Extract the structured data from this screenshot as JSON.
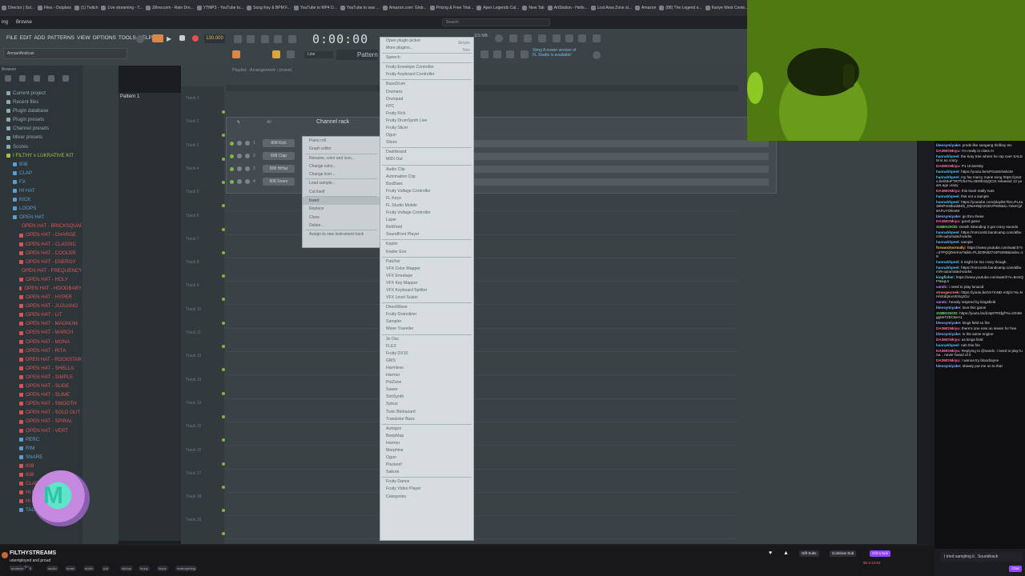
{
  "bookmarks": [
    "Director | Sol...",
    "Files - Dropbox",
    "(1) Twitch",
    "Live streaming - T...",
    "Zillow.com - Rain Dro...",
    "YTMP3 - YouTube to...",
    "Song Key & BPM F...",
    "YouTube to MP4 D...",
    "YouTube to wav ...",
    "Amazon.com: Glob...",
    "Pricing & Free Trial...",
    "Apex Legends Cal...",
    "New Tab",
    "ArtStation - Hello...",
    "Lost Area Zone st...",
    "Amazon",
    "(88) The Legend o...",
    "Kanye West Conte...",
    "Visually Plan, Man..."
  ],
  "topbar": {
    "left1": "ing",
    "left2": "Browse",
    "search_placeholder": "Search"
  },
  "fl": {
    "menu": [
      "FILE",
      "EDIT",
      "ADD",
      "PATTERNS",
      "VIEW",
      "OPTIONS",
      "TOOLS",
      "HELP"
    ],
    "hint": "AnnaelAndican",
    "bpm": "130.000",
    "time": "0:00:00",
    "pattern_label": "Pattern",
    "snap_label": "Line",
    "notice_line1": "Strng  A newer version of",
    "notice_line2": "FL Studio is available!",
    "memory": "115 MB",
    "browser_title": "Browser",
    "playlist_title": "Playlist - Arrangement › (none)"
  },
  "browser_tree": [
    {
      "label": "Current project",
      "color": "#8fa8b3"
    },
    {
      "label": "Recent files",
      "color": "#8fa8b3"
    },
    {
      "label": "Plugin database",
      "color": "#8fa8b3"
    },
    {
      "label": "Plugin presets",
      "color": "#8fa8b3"
    },
    {
      "label": "Channel presets",
      "color": "#8fa8b3"
    },
    {
      "label": "Mixer presets",
      "color": "#8fa8b3"
    },
    {
      "label": "Scores",
      "color": "#8fa8b3"
    },
    {
      "label": "I FILTHY x LUKRATIVE KIT",
      "color": "#9fc24b"
    },
    {
      "label": "808",
      "color": "#5b9ed1"
    },
    {
      "label": "CLAP",
      "color": "#5b9ed1"
    },
    {
      "label": "FX",
      "color": "#5b9ed1"
    },
    {
      "label": "HI HAT",
      "color": "#5b9ed1"
    },
    {
      "label": "KICK",
      "color": "#5b9ed1"
    },
    {
      "label": "LOOPS",
      "color": "#5b9ed1"
    },
    {
      "label": "OPEN HAT",
      "color": "#5b9ed1"
    },
    {
      "label": "OPEN HAT - BRICKSQUAD",
      "color": "#d9555e"
    },
    {
      "label": "OPEN HAT - CHARGE",
      "color": "#d9555e"
    },
    {
      "label": "OPEN HAT - CLASSIC",
      "color": "#d9555e"
    },
    {
      "label": "OPEN HAT - COOLER",
      "color": "#d9555e"
    },
    {
      "label": "OPEN HAT - ENERGY",
      "color": "#d9555e"
    },
    {
      "label": "OPEN HAT - FREQUENCY",
      "color": "#d9555e"
    },
    {
      "label": "OPEN HAT - HOLY",
      "color": "#d9555e"
    },
    {
      "label": "OPEN HAT - HOODBABY",
      "color": "#d9555e"
    },
    {
      "label": "OPEN HAT - HYPER",
      "color": "#d9555e"
    },
    {
      "label": "OPEN HAT - JUJUANO",
      "color": "#d9555e"
    },
    {
      "label": "OPEN HAT - LIT",
      "color": "#d9555e"
    },
    {
      "label": "OPEN HAT - MAGNUM",
      "color": "#d9555e"
    },
    {
      "label": "OPEN HAT - MARCH",
      "color": "#d9555e"
    },
    {
      "label": "OPEN HAT - MONA",
      "color": "#d9555e"
    },
    {
      "label": "OPEN HAT - RITA",
      "color": "#d9555e"
    },
    {
      "label": "OPEN HAT - ROCKSTAR",
      "color": "#d9555e"
    },
    {
      "label": "OPEN HAT - SHELLS",
      "color": "#d9555e"
    },
    {
      "label": "OPEN HAT - SIMPLE",
      "color": "#d9555e"
    },
    {
      "label": "OPEN HAT - SLIDE",
      "color": "#d9555e"
    },
    {
      "label": "OPEN HAT - SLIME",
      "color": "#d9555e"
    },
    {
      "label": "OPEN HAT - SMOOTH",
      "color": "#d9555e"
    },
    {
      "label": "OPEN HAT - SOLD OUT",
      "color": "#d9555e"
    },
    {
      "label": "OPEN HAT - SPIRAL",
      "color": "#d9555e"
    },
    {
      "label": "OPEN HAT - VERT",
      "color": "#d9555e"
    },
    {
      "label": "PERC",
      "color": "#5b9ed1"
    },
    {
      "label": "RIM",
      "color": "#5b9ed1"
    },
    {
      "label": "SNARE",
      "color": "#5b9ed1"
    },
    {
      "label": "808",
      "color": "#d9555e"
    },
    {
      "label": "808",
      "color": "#d9555e"
    },
    {
      "label": "CLAP",
      "color": "#d9555e"
    },
    {
      "label": "HI HAT",
      "color": "#d9555e"
    },
    {
      "label": "HI HAT - DARK",
      "color": "#d9555e"
    },
    {
      "label": "TAGS",
      "color": "#5b9ed1"
    }
  ],
  "pattern": "Pattern 1",
  "tracks": [
    "Track 1",
    "Track 2",
    "Track 3",
    "Track 4",
    "Track 5",
    "Track 6",
    "Track 7",
    "Track 8",
    "Track 9",
    "Track 10",
    "Track 11",
    "Track 12",
    "Track 13",
    "Track 14",
    "Track 15",
    "Track 16",
    "Track 17",
    "Track 18",
    "Track 19"
  ],
  "channel_rack": {
    "title": "Channel rack",
    "filter": "All",
    "channels": [
      {
        "num": "1",
        "name": "808 Kick"
      },
      {
        "num": "2",
        "name": "808 Clap"
      },
      {
        "num": "3",
        "name": "808 HiHat"
      },
      {
        "num": "4",
        "name": "808 Snare"
      }
    ]
  },
  "context_menu": {
    "items": [
      "Piano roll",
      "Graph editor",
      "-",
      "Rename, color and icon...",
      "Change color...",
      "Change icon...",
      "-",
      "Load sample...",
      "Cut itself",
      "-",
      "Insert",
      "Replace",
      "Clone",
      "Delete...",
      "-",
      "Assign to new instrument track"
    ],
    "tail": [
      "Clone",
      "Delete..."
    ]
  },
  "submenu": {
    "side_labels": [
      "Simple",
      "Tree"
    ],
    "items": [
      "Open plugin picker",
      "More plugins...",
      "-",
      "Speech",
      "-",
      "Fruity Envelope Controller",
      "Fruity Keyboard Controller",
      "-",
      "BassDrum",
      "Drumaxx",
      "Drumpad",
      "FPC",
      "Fruity Kick",
      "Fruity DrumSynth Live",
      "Fruity Slicer",
      "Ogun",
      "Slicex",
      "-",
      "Dashboard",
      "MIDI Out",
      "-",
      "Audio Clip",
      "Automation Clip",
      "BooBass",
      "Fruity Voltage Controller",
      "FL Keys",
      "FL Studio Mobile",
      "Fruity Voltage Controller",
      "Layer",
      "ReWired",
      "SoundFont Player",
      "-",
      "Kepler",
      "Kepler Exo",
      "-",
      "Patcher",
      "VFX Color Mapper",
      "VFX Envelope",
      "VFX Key Mapper",
      "VFX Keyboard Splitter",
      "VFX Level Scaler",
      "-",
      "DirectWave",
      "Fruity Granulizer",
      "Sampler",
      "Wave Traveller",
      "-",
      "3x Osc",
      "FLEX",
      "Fruity DX10",
      "GMS",
      "Harmless",
      "Harmor",
      "PoiZone",
      "Sawer",
      "SimSynth",
      "Sytrus",
      "Toxic Biohazard",
      "Transistor Bass",
      "-",
      "Autogun",
      "BeepMap",
      "Harmor",
      "Morphine",
      "Ogun",
      "Plucked!",
      "Sakura",
      "-",
      "Fruity Dance",
      "Fruity Video Player",
      "Categories"
    ]
  },
  "chat": [
    {
      "user": "blessymiyake:",
      "text": "prods like sangang thrilboy etc",
      "color": "#7fb3ff"
    },
    {
      "user": "DA3MONkiyu:",
      "text": "I'm really in class rn",
      "color": "#ff6fa8"
    },
    {
      "user": "hannahhpeel:",
      "text": "the kray tree where he rap over SALEM is so crazy",
      "color": "#4cc3ff"
    },
    {
      "user": "DA3MONkiyu:",
      "text": "P1 University",
      "color": "#ff6fa8"
    },
    {
      "user": "hannahhpeel:",
      "text": "https://youtu.be/uFDu8mhwkcM",
      "color": "#4cc3ff"
    },
    {
      "user": "hannahhpeel:",
      "text": "my fav marcy mane song https://youtu.be/83oFTR7fVb4?si=5D9f2I2jQCtX released 12 years ago crazy",
      "color": "#4cc3ff"
    },
    {
      "user": "DA3MONkiyu:",
      "text": "this track really nuts",
      "color": "#ff6fa8"
    },
    {
      "user": "hannahhpeel:",
      "text": "this not a sample",
      "color": "#4cc3ff"
    },
    {
      "user": "hannahhpeel:",
      "text": "https://youtube.com/playlist?list=PL4a38NPm5tkw3BSb_DNeHWjn2GEVP8W&si=7ekeCjZ8AFUYOEmM",
      "color": "#4cc3ff"
    },
    {
      "user": "blessymiyake:",
      "text": "go thru these",
      "color": "#7fb3ff"
    },
    {
      "user": "DA3MONkiyu:",
      "text": "good game",
      "color": "#ff6fa8"
    },
    {
      "user": "318BGOIOD:",
      "text": "Death Stranding 2 got crazy sounds",
      "color": "#6be36b"
    },
    {
      "user": "hannahhpeel:",
      "text": "https://mmcords.bandcamp.com/album/9-automated-works",
      "color": "#4cc3ff"
    },
    {
      "user": "hannahhpeel:",
      "text": "sample",
      "color": "#4cc3ff"
    },
    {
      "user": "forwardnormally:",
      "text": "https://www.youtube.com/watch?v=37PQQ0mrKw7&list=PL2D0N82744F5098&index=19",
      "color": "#ffb347"
    },
    {
      "user": "hannahhpeel:",
      "text": "it might be too crazy though",
      "color": "#4cc3ff"
    },
    {
      "user": "hannahhpeel:",
      "text": "https://mmcords.bandcamp.com/album/9-automated-works",
      "color": "#4cc3ff"
    },
    {
      "user": "kingfisher:",
      "text": "https://www.youtube.com/watch?v=9cmQFNxqL0",
      "color": "#67d1c9"
    },
    {
      "user": "vandc:",
      "text": "i need to play lunacid",
      "color": "#c285ff"
    },
    {
      "user": "strangecreek:",
      "text": "https://youtu.be/2n7mND-m0j2c?si=NHNSdqmxVESqJCU",
      "color": "#ff8080"
    },
    {
      "user": "vandc:",
      "text": "heavily inspired by kingsfield",
      "color": "#c285ff"
    },
    {
      "user": "blessymiyake:",
      "text": "love this game",
      "color": "#7fb3ff"
    },
    {
      "user": "318BGOIOD:",
      "text": "https://youtu.be/dJq87RSfgf?si=G04Mgg0eT2EC6eA1",
      "color": "#6be36b"
    },
    {
      "user": "blessymiyake:",
      "text": "kings field so fire",
      "color": "#7fb3ff"
    },
    {
      "user": "DA3MONkiyu:",
      "text": "there's one new on steam for free",
      "color": "#ff6fa8"
    },
    {
      "user": "blessymiyake:",
      "text": "in the same engine",
      "color": "#7fb3ff"
    },
    {
      "user": "DA3MONkiyu:",
      "text": "as kings field",
      "color": "#ff6fa8"
    },
    {
      "user": "hannahhpeel:",
      "text": "nah this fire",
      "color": "#4cc3ff"
    },
    {
      "user": "DA3MONkiyu:",
      "text": "Replying to @vandc: i need to play luna... never heard of it",
      "color": "#ff6fa8"
    },
    {
      "user": "DA3MONkiyu:",
      "text": "i wanna try bloodrayne",
      "color": "#ff6fa8"
    },
    {
      "user": "blessymiyake:",
      "text": "shawty put me on to that",
      "color": "#7fb3ff"
    }
  ],
  "chat_input": "I tried sampling it . Soundtrack",
  "stream": {
    "channel": "FILTHYSTREAMS",
    "title": "unemployed and proud",
    "category": "Just Chatting",
    "tags": [
      "producer",
      "fl",
      "studio",
      "beats",
      "audio",
      "pull",
      "hiphop",
      "funny",
      "loops",
      "makeupthing"
    ],
    "actions": [
      "Gift Subs",
      "Continue Sub",
      "Gift a Sub"
    ],
    "viewers": "65  2:13:54",
    "chat_button": "Chat"
  },
  "colors": {
    "accent": "#9147ff",
    "fl_green": "#7cb83e",
    "bpm": "#e8bb56"
  }
}
